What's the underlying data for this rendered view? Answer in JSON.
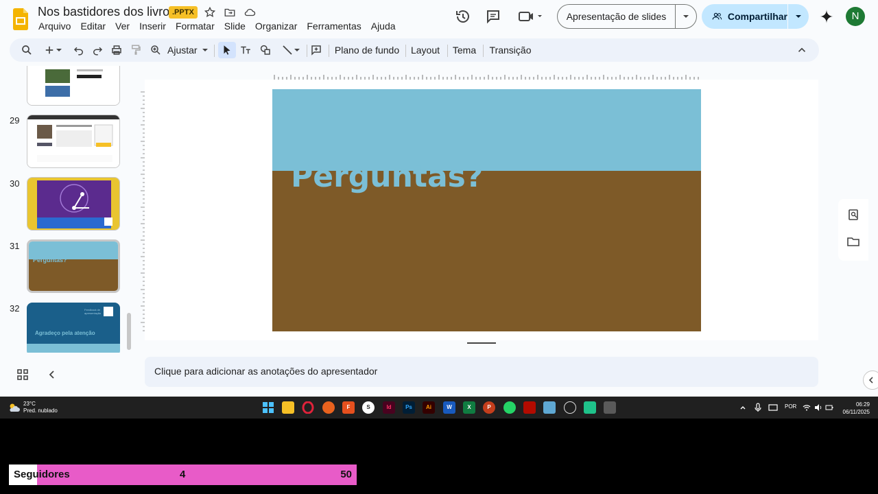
{
  "header": {
    "title": "Nos bastidores dos livros",
    "file_badge": ".PPTX",
    "menu": [
      "Arquivo",
      "Editar",
      "Ver",
      "Inserir",
      "Formatar",
      "Slide",
      "Organizar",
      "Ferramentas",
      "Ajuda"
    ],
    "slideshow_label": "Apresentação de slides",
    "share_label": "Compartilhar",
    "avatar_initial": "N"
  },
  "toolbar": {
    "zoom_label": "Ajustar",
    "background_label": "Plano de fundo",
    "layout_label": "Layout",
    "theme_label": "Tema",
    "transition_label": "Transição"
  },
  "filmstrip": {
    "slides": [
      {
        "number": "29"
      },
      {
        "number": "30"
      },
      {
        "number": "31"
      },
      {
        "number": "32"
      }
    ],
    "thumb_31_text": "Perguntas?",
    "thumb_32_title": "Agradeço pela atenção",
    "thumb_32_small": "Feedback de apresentação"
  },
  "slide": {
    "title": "Perguntas?",
    "colors": {
      "band": "#7bbfd6",
      "background": "#7e5a28"
    }
  },
  "notes": {
    "placeholder": "Clique para adicionar as anotações do apresentador"
  },
  "taskbar": {
    "weather_temp": "23°C",
    "weather_desc": "Pred. nublado",
    "language": "POR",
    "time": "06:29",
    "date": "06/11/2025",
    "apps": [
      "windows-start",
      "file-explorer",
      "opera",
      "firefox",
      "foxit",
      "app-s",
      "indesign",
      "photoshop",
      "illustrator",
      "word",
      "excel",
      "powerpoint",
      "whatsapp",
      "acrobat",
      "notepad",
      "app-circle",
      "app-green",
      "calculator"
    ]
  },
  "overlay": {
    "label": "Seguidores",
    "current": "4",
    "goal": "50",
    "progress_fraction": 0.08
  }
}
